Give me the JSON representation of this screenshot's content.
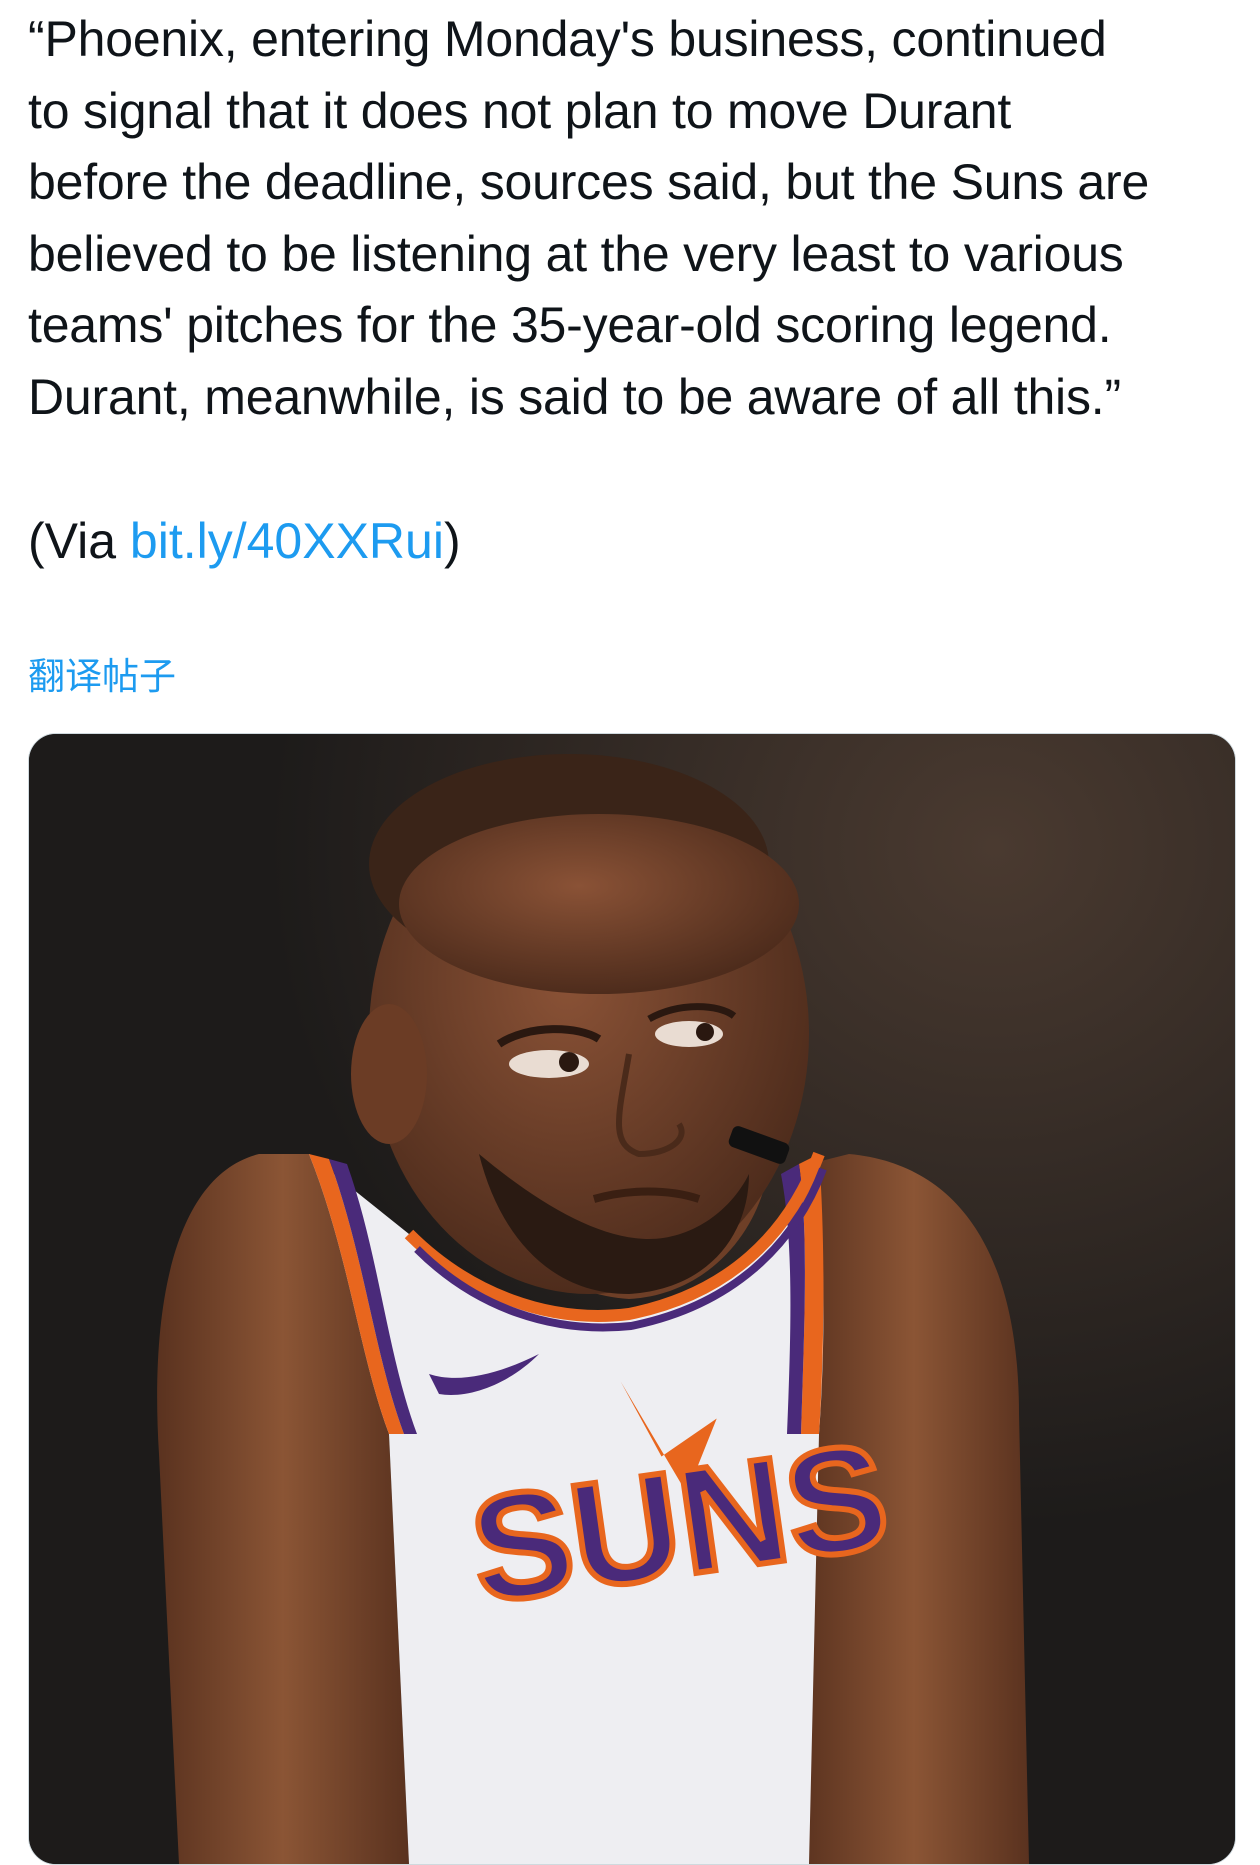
{
  "post": {
    "quote_text": "“Phoenix, entering Monday's business, continued\nto signal that it does not plan to move Durant\nbefore the deadline, sources said, but the Suns are\nbelieved to be listening at the very least to various\nteams' pitches for the 35-year-old scoring legend.\nDurant, meanwhile, is said to be aware of all this.”",
    "via_prefix": "(Via ",
    "via_link": "bit.ly/40XXRui",
    "via_suffix": ")",
    "translate_label": "翻译帖子"
  },
  "media": {
    "jersey_wordmark": "SUNS",
    "colors": {
      "background": "#1d1b1a",
      "skin": "#7a4a30",
      "jersey": "#eeeef2",
      "trim_orange": "#e8661e",
      "trim_purple": "#4a2a7a",
      "link_blue": "#1d9bf0"
    }
  }
}
